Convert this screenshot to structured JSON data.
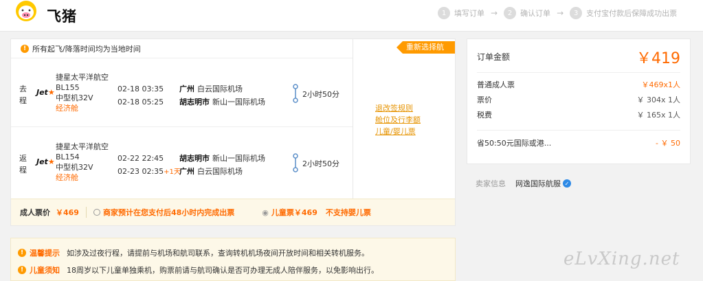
{
  "header": {
    "brand": "飞猪",
    "steps": [
      {
        "num": "1",
        "label": "填写订单"
      },
      {
        "num": "2",
        "label": "确认订单"
      },
      {
        "num": "3",
        "label": "支付宝付款后保障成功出票"
      }
    ],
    "arrow": "→"
  },
  "flight": {
    "notice": "所有起飞/降落时间均为当地时间",
    "notice_icon": "!",
    "reselect_label": "重新选择航班",
    "legs": [
      {
        "tag": "去程",
        "airline_logo": "Jet",
        "airline": "捷星太平洋航空",
        "flight_no": "BL155",
        "aircraft": "中型机32V",
        "cabin": "经济舱",
        "dep_time": "02-18 03:35",
        "arr_time": "02-18 05:25",
        "arr_plus": "",
        "dep_city": "广州",
        "dep_airport": "白云国际机场",
        "arr_city": "胡志明市",
        "arr_airport": "新山一国际机场",
        "duration": "2小时50分"
      },
      {
        "tag": "返程",
        "airline_logo": "Jet",
        "airline": "捷星太平洋航空",
        "flight_no": "BL154",
        "aircraft": "中型机32V",
        "cabin": "经济舱",
        "dep_time": "02-22 22:45",
        "arr_time": "02-23 02:35",
        "arr_plus": "+1天",
        "dep_city": "胡志明市",
        "dep_airport": "新山一国际机场",
        "arr_city": "广州",
        "arr_airport": "白云国际机场",
        "duration": "2小时50分"
      }
    ],
    "policy_links": [
      "退改签规则",
      "舱位及行李额",
      "儿童/婴儿票"
    ],
    "price_strip": {
      "adult_label": "成人票价",
      "adult_price": "￥469",
      "issue_note": "商家预计在您支付后48小时内完成出票",
      "child_label": "儿童票￥469",
      "infant_note": "不支持婴儿票"
    }
  },
  "tips": [
    {
      "label": "温馨提示",
      "text": "如涉及过夜行程，请提前与机场和航司联系，查询转机机场夜间开放时间和相关转机服务。"
    },
    {
      "label": "儿童须知",
      "text": "18周岁以下儿童单独乘机，购票前请与航司确认是否可办理无成人陪伴服务，以免影响出行。"
    }
  ],
  "order": {
    "title": "订单金额",
    "total": "￥419",
    "rows": [
      {
        "label": "普通成人票",
        "value": "￥469x1人"
      },
      {
        "label": "票价",
        "value": "￥ 304x 1人"
      },
      {
        "label": "税费",
        "value": "￥ 165x 1人"
      }
    ],
    "discount_label": "省50:50元国际或港...",
    "discount_value": "- ￥ 50"
  },
  "seller": {
    "label": "卖家信息",
    "name": "网逸国际航服"
  },
  "watermark": "eLvXing.net",
  "colors": {
    "accent": "#ff6a00",
    "orange_tag": "#ff9a00",
    "strip_bg": "#fdf8e8"
  }
}
